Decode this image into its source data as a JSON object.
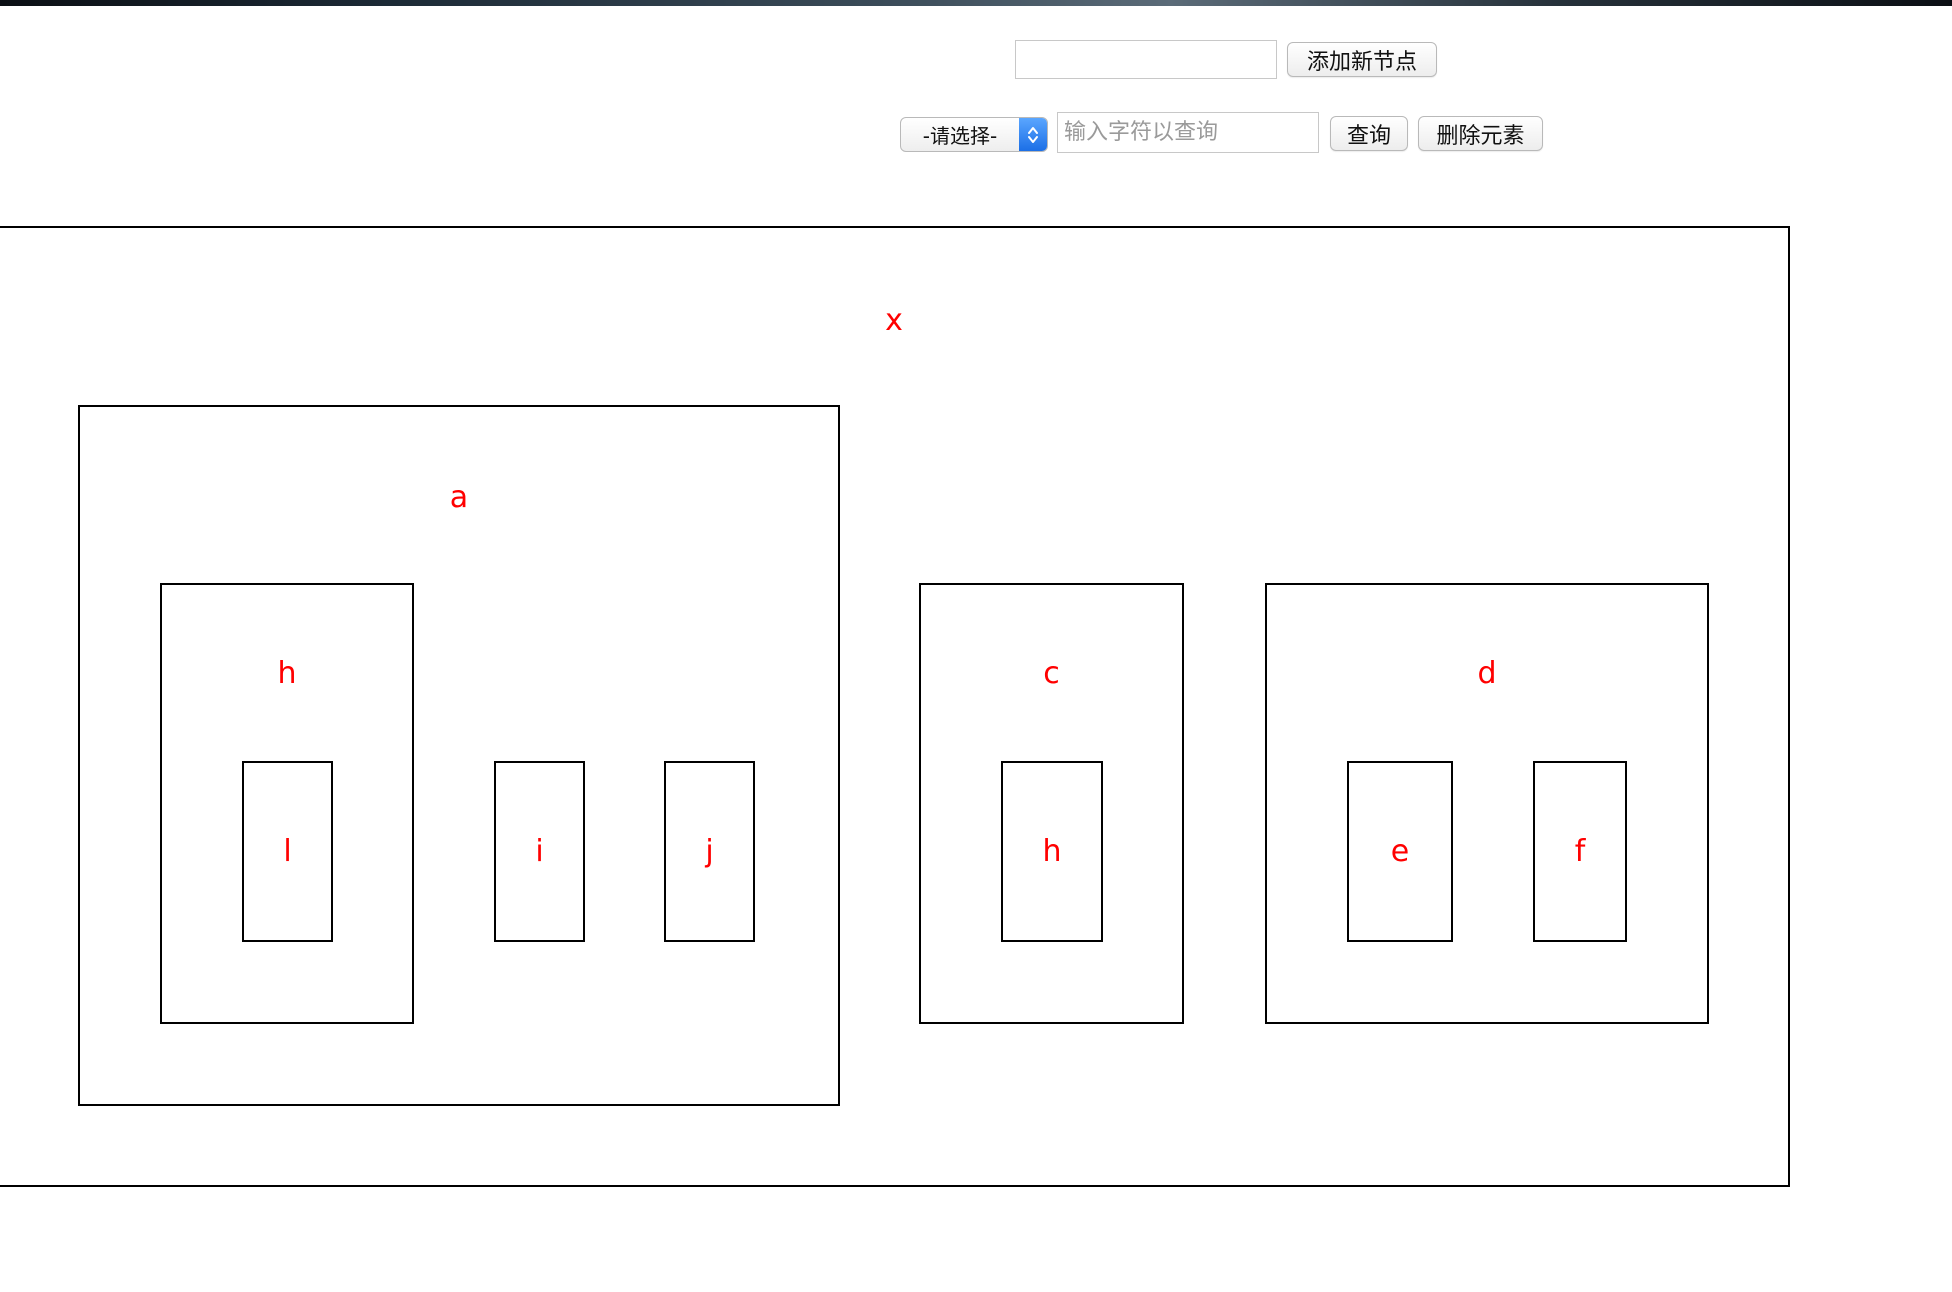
{
  "toolbar": {
    "add_input_value": "",
    "add_button_label": "添加新节点",
    "select_label": "-请选择-",
    "search_placeholder": "输入字符以查询",
    "search_button_label": "查询",
    "delete_button_label": "删除元素"
  },
  "tree": {
    "root": "x",
    "a": "a",
    "a_h": "h",
    "a_h_l": "l",
    "a_i": "i",
    "a_j": "j",
    "c": "c",
    "c_h": "h",
    "d": "d",
    "d_e": "e",
    "d_f": "f"
  },
  "colors": {
    "label": "#ff0000",
    "border": "#000000",
    "select_accent": "#1c6fe6"
  }
}
